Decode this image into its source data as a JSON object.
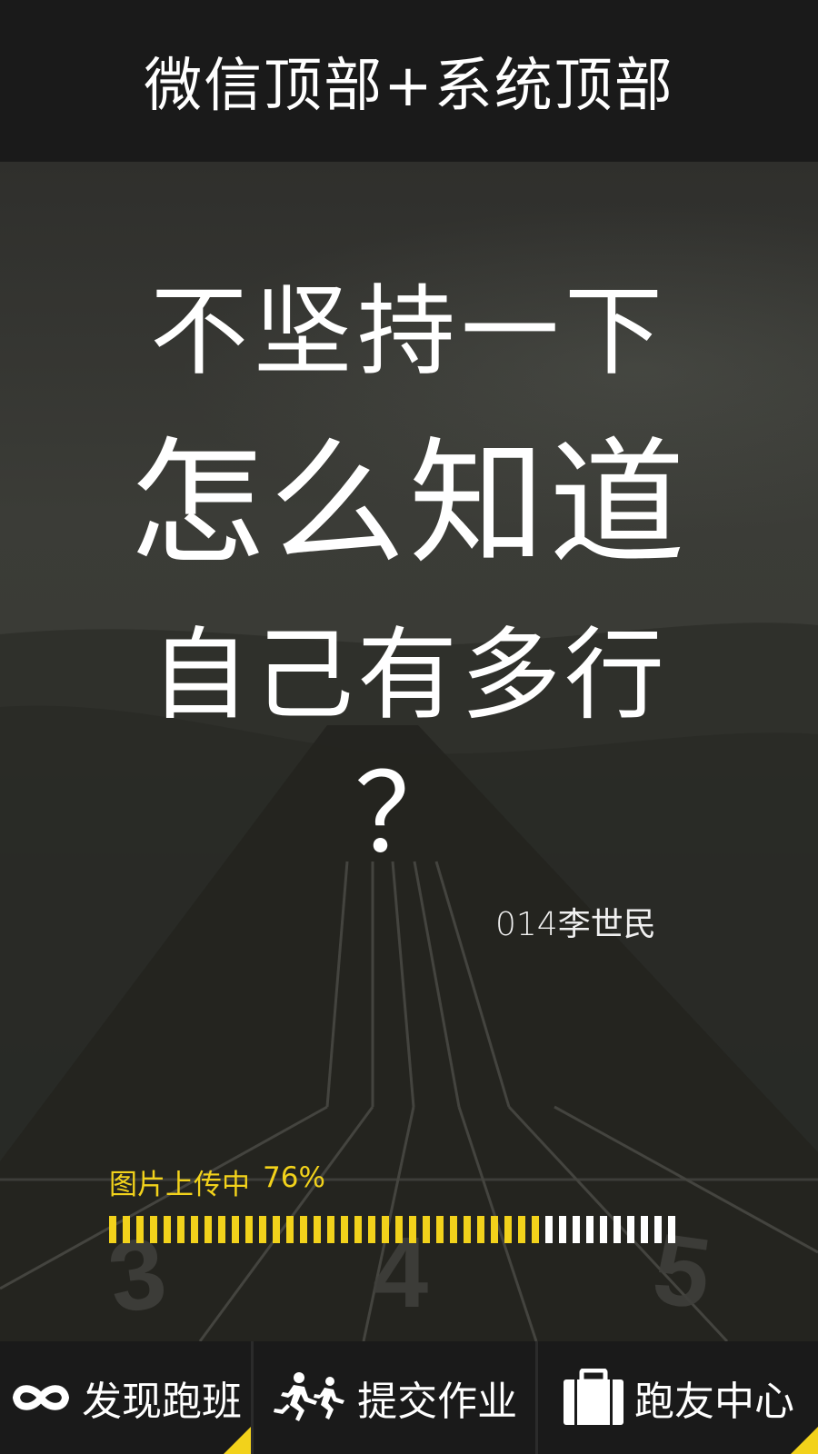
{
  "header": {
    "title": "微信顶部+系统顶部"
  },
  "hero": {
    "line1": "不坚持一下",
    "line2": "怎么知道",
    "line3": "自己有多行",
    "line4": "？",
    "author": "014李世民"
  },
  "upload": {
    "label": "图片上传中",
    "percent_text": "76%",
    "progress": 0.76,
    "segment_count": 42,
    "filled_color": "#f2d21b",
    "empty_color": "#ffffff"
  },
  "tabs": [
    {
      "label": "发现跑班",
      "icon": "infinity-icon"
    },
    {
      "label": "提交作业",
      "icon": "runners-icon"
    },
    {
      "label": "跑友中心",
      "icon": "briefcase-icon"
    }
  ],
  "colors": {
    "accent": "#f2d21b",
    "bar_bg": "#1a1a1a"
  }
}
